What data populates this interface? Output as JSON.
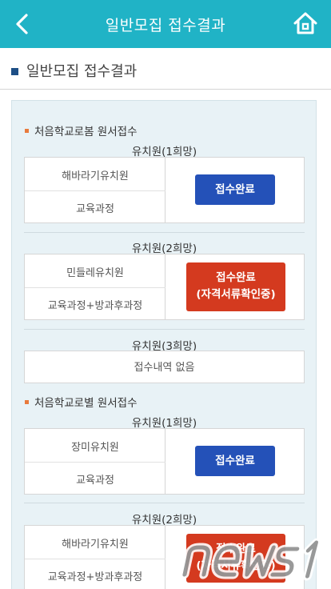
{
  "header": {
    "title": "일반모집 접수결과"
  },
  "page": {
    "heading": "일반모집 접수결과"
  },
  "sections": [
    {
      "title": "처음학교로봄 원서접수",
      "choices": [
        {
          "label": "유치원(1희망)",
          "school": "해바라기유치원",
          "course": "교육과정",
          "status": "접수완료"
        },
        {
          "label": "유치원(2희망)",
          "school": "민들레유치원",
          "course": "교육과정+방과후과정",
          "status": "접수완료",
          "status_sub": "(자격서류확인중)"
        },
        {
          "label": "유치원(3희망)",
          "empty": "접수내역 없음"
        }
      ]
    },
    {
      "title": "처음학교로별 원서접수",
      "choices": [
        {
          "label": "유치원(1희망)",
          "school": "장미유치원",
          "course": "교육과정",
          "status": "접수완료"
        },
        {
          "label": "유치원(2희망)",
          "school": "해바라기유치원",
          "course": "교육과정+방과후과정",
          "status": "접수완료",
          "status_sub": "(자격서류확인중)"
        }
      ]
    }
  ],
  "watermark": {
    "text": "news1"
  },
  "colors": {
    "header": "#20b3c6",
    "blue_button": "#2451b8",
    "red_button": "#d43a1f",
    "panel": "#e8f2f6",
    "bullet": "#e87a3c"
  }
}
